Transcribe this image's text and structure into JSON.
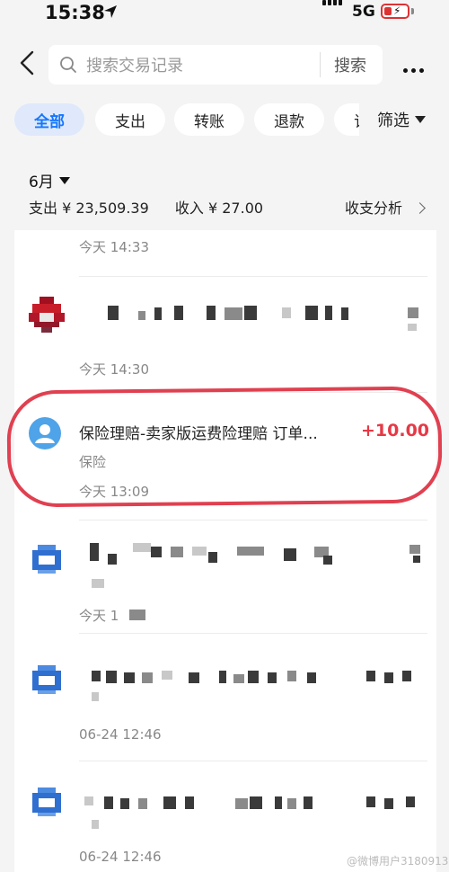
{
  "status_bar": {
    "time": "15:38",
    "network": "5G"
  },
  "search": {
    "placeholder": "搜索交易记录",
    "button_label": "搜索"
  },
  "filters": {
    "chips": [
      {
        "label": "全部",
        "active": true
      },
      {
        "label": "支出",
        "active": false
      },
      {
        "label": "转账",
        "active": false
      },
      {
        "label": "退款",
        "active": false
      },
      {
        "label": "订",
        "active": false
      }
    ],
    "filter_label": "筛选"
  },
  "summary": {
    "month": "6月",
    "expense": "支出 ¥ 23,509.39",
    "income": "收入 ¥ 27.00",
    "analysis_label": "收支分析"
  },
  "transactions": [
    {
      "time": "今天 14:33"
    },
    {
      "time": "今天 14:30"
    },
    {
      "title": "保险理赔-卖家版运费险理赔 订单...",
      "amount": "+10.00",
      "category": "保险",
      "time": "今天 13:09"
    },
    {
      "time": "今天 1"
    },
    {
      "time": "06-24 12:46"
    },
    {
      "time": "06-24 12:46"
    }
  ],
  "watermark": "@微博用户3180913",
  "colors": {
    "accent": "#1677ff",
    "income": "#e63946",
    "highlight_ring": "#e04050"
  }
}
